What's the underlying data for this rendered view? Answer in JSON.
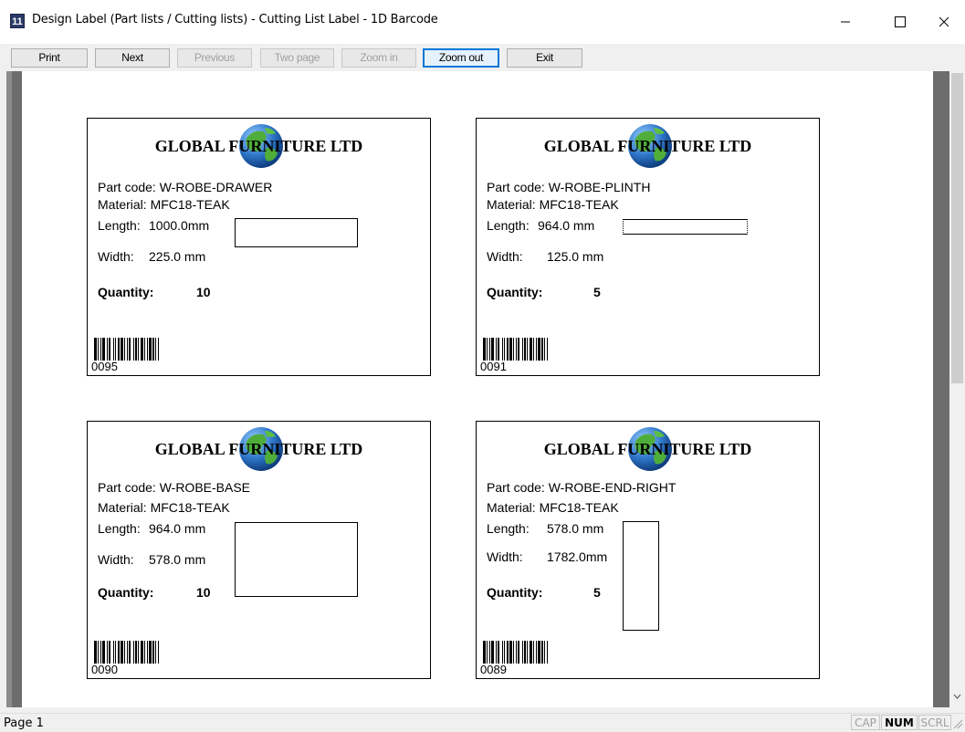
{
  "window": {
    "title": "Design Label (Part lists / Cutting lists) - Cutting List Label - 1D Barcode",
    "app_icon_text": "11"
  },
  "toolbar": {
    "buttons": [
      {
        "label": "Print",
        "enabled": true
      },
      {
        "label": "Next",
        "enabled": true
      },
      {
        "label": "Previous",
        "enabled": false
      },
      {
        "label": "Two page",
        "enabled": false
      },
      {
        "label": "Zoom in",
        "enabled": false
      },
      {
        "label": "Zoom out",
        "enabled": true,
        "focused": true
      },
      {
        "label": "Exit",
        "enabled": true
      }
    ]
  },
  "labels": [
    {
      "company": "GLOBAL FURNITURE LTD",
      "part_code": "Part code: W-ROBE-DRAWER",
      "material": "Material: MFC18-TEAK",
      "length_label": "Length:",
      "length_value": "1000.0mm",
      "width_label": "Width:",
      "width_value": "225.0 mm",
      "quantity_label": "Quantity:",
      "quantity_value": "10",
      "barcode_number": "0095"
    },
    {
      "company": "GLOBAL FURNITURE LTD",
      "part_code": "Part code: W-ROBE-PLINTH",
      "material": "Material: MFC18-TEAK",
      "length_label": "Length:",
      "length_value": "964.0 mm",
      "width_label": "Width:",
      "width_value": "125.0 mm",
      "quantity_label": "Quantity:",
      "quantity_value": "5",
      "barcode_number": "0091"
    },
    {
      "company": "GLOBAL FURNITURE LTD",
      "part_code": "Part code: W-ROBE-BASE",
      "material": "Material: MFC18-TEAK",
      "length_label": "Length:",
      "length_value": "964.0 mm",
      "width_label": "Width:",
      "width_value": "578.0 mm",
      "quantity_label": "Quantity:",
      "quantity_value": "10",
      "barcode_number": "0090"
    },
    {
      "company": "GLOBAL FURNITURE LTD",
      "part_code": "Part code: W-ROBE-END-RIGHT",
      "material": "Material: MFC18-TEAK",
      "length_label": "Length:",
      "length_value": "578.0 mm",
      "width_label": "Width:",
      "width_value": "1782.0mm",
      "quantity_label": "Quantity:",
      "quantity_value": "5",
      "barcode_number": "0089"
    }
  ],
  "statusbar": {
    "page": "Page 1",
    "indicators": [
      {
        "label": "CAP",
        "on": false
      },
      {
        "label": "NUM",
        "on": true
      },
      {
        "label": "SCRL",
        "on": false
      }
    ]
  }
}
